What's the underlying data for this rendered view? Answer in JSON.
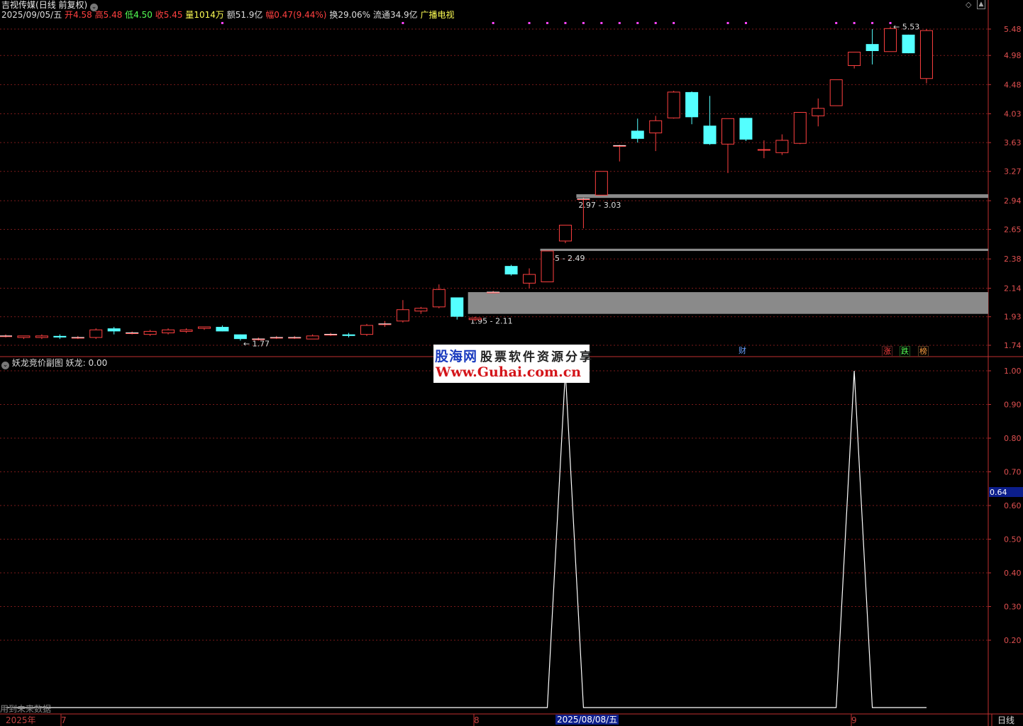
{
  "header": {
    "stock_name": "吉视传媒",
    "period_label": "(日线 前复权)",
    "date": "2025/09/05/五",
    "open_label": "开",
    "open": "4.58",
    "high_label": "高",
    "high": "5.48",
    "low_label": "低",
    "low": "4.50",
    "close_label": "收",
    "close": "5.45",
    "volume_label": "量",
    "volume": "1014万",
    "amount_label": "额",
    "amount": "51.9亿",
    "change_label": "幅",
    "change": "0.47(9.44%)",
    "turnover_label": "换",
    "turnover": "29.06%",
    "float_label": "流通",
    "float": "34.9亿",
    "sector": "广播电视"
  },
  "sub_header": {
    "indicator_name": "妖龙竞价副图",
    "series_label": "妖龙:",
    "series_value": "0.00"
  },
  "bottom_left_note": "用到未来数据",
  "x_axis": {
    "year": "2025年",
    "months": [
      "7",
      "8",
      "9"
    ],
    "selected_date": "2025/08/08/五",
    "period": "日线"
  },
  "badges": {
    "cai": "财",
    "zhang": "涨",
    "die": "跌",
    "bang": "榜"
  },
  "watermark": {
    "line1": "股海网",
    "line1b": "股票软件资源分享",
    "line2": "Www.Guhai.com.cn"
  },
  "colors": {
    "up": "#ff4040",
    "down": "#54ffff",
    "grid": "#7a1a1a",
    "border": "#c03030",
    "zone": "#8a8a8a",
    "indicator": "#ffffff",
    "magenta": "#ff44ff"
  },
  "chart_data": [
    {
      "type": "candlestick",
      "y_ticks": [
        5.48,
        4.98,
        4.48,
        4.03,
        3.63,
        3.27,
        2.94,
        2.65,
        2.38,
        2.14,
        1.93,
        1.74
      ],
      "y_scale": "log",
      "candles": [
        {
          "o": 1.8,
          "h": 1.81,
          "l": 1.79,
          "c": 1.8
        },
        {
          "o": 1.79,
          "h": 1.8,
          "l": 1.78,
          "c": 1.8
        },
        {
          "o": 1.79,
          "h": 1.81,
          "l": 1.78,
          "c": 1.8
        },
        {
          "o": 1.8,
          "h": 1.81,
          "l": 1.78,
          "c": 1.79
        },
        {
          "o": 1.79,
          "h": 1.8,
          "l": 1.78,
          "c": 1.79
        },
        {
          "o": 1.79,
          "h": 1.85,
          "l": 1.78,
          "c": 1.84
        },
        {
          "o": 1.85,
          "h": 1.86,
          "l": 1.81,
          "c": 1.83
        },
        {
          "o": 1.82,
          "h": 1.83,
          "l": 1.81,
          "c": 1.82
        },
        {
          "o": 1.81,
          "h": 1.84,
          "l": 1.8,
          "c": 1.83
        },
        {
          "o": 1.82,
          "h": 1.85,
          "l": 1.81,
          "c": 1.84
        },
        {
          "o": 1.83,
          "h": 1.85,
          "l": 1.82,
          "c": 1.84
        },
        {
          "o": 1.85,
          "h": 1.86,
          "l": 1.84,
          "c": 1.86
        },
        {
          "o": 1.86,
          "h": 1.87,
          "l": 1.83,
          "c": 1.83
        },
        {
          "o": 1.81,
          "h": 1.81,
          "l": 1.77,
          "c": 1.78
        },
        {
          "o": 1.78,
          "h": 1.79,
          "l": 1.77,
          "c": 1.78
        },
        {
          "o": 1.79,
          "h": 1.8,
          "l": 1.78,
          "c": 1.79
        },
        {
          "o": 1.79,
          "h": 1.8,
          "l": 1.78,
          "c": 1.79
        },
        {
          "o": 1.78,
          "h": 1.81,
          "l": 1.78,
          "c": 1.8
        },
        {
          "o": 1.81,
          "h": 1.82,
          "l": 1.8,
          "c": 1.81
        },
        {
          "o": 1.81,
          "h": 1.82,
          "l": 1.79,
          "c": 1.8
        },
        {
          "o": 1.81,
          "h": 1.88,
          "l": 1.8,
          "c": 1.87
        },
        {
          "o": 1.88,
          "h": 1.9,
          "l": 1.86,
          "c": 1.88
        },
        {
          "o": 1.9,
          "h": 2.05,
          "l": 1.89,
          "c": 1.98
        },
        {
          "o": 1.97,
          "h": 2.0,
          "l": 1.95,
          "c": 1.99
        },
        {
          "o": 2.0,
          "h": 2.17,
          "l": 1.99,
          "c": 2.13
        },
        {
          "o": 2.07,
          "h": 2.07,
          "l": 1.91,
          "c": 1.93
        },
        {
          "o": 1.91,
          "h": 1.93,
          "l": 1.9,
          "c": 1.92
        },
        {
          "o": 2.11,
          "h": 2.12,
          "l": 2.11,
          "c": 2.11
        },
        {
          "o": 2.32,
          "h": 2.33,
          "l": 2.24,
          "c": 2.25
        },
        {
          "o": 2.18,
          "h": 2.3,
          "l": 2.14,
          "c": 2.25
        },
        {
          "o": 2.19,
          "h": 2.45,
          "l": 2.19,
          "c": 2.45
        },
        {
          "o": 2.54,
          "h": 2.69,
          "l": 2.52,
          "c": 2.69
        },
        {
          "o": 2.96,
          "h": 2.97,
          "l": 2.66,
          "c": 2.96
        },
        {
          "o": 3.0,
          "h": 3.27,
          "l": 3.0,
          "c": 3.27
        },
        {
          "o": 3.59,
          "h": 3.6,
          "l": 3.39,
          "c": 3.59
        },
        {
          "o": 3.79,
          "h": 3.96,
          "l": 3.63,
          "c": 3.68
        },
        {
          "o": 3.76,
          "h": 4.0,
          "l": 3.52,
          "c": 3.93
        },
        {
          "o": 3.97,
          "h": 4.38,
          "l": 3.96,
          "c": 4.36
        },
        {
          "o": 4.36,
          "h": 4.37,
          "l": 3.88,
          "c": 3.98
        },
        {
          "o": 3.86,
          "h": 4.3,
          "l": 3.6,
          "c": 3.61
        },
        {
          "o": 3.61,
          "h": 3.96,
          "l": 3.25,
          "c": 3.96
        },
        {
          "o": 3.97,
          "h": 3.97,
          "l": 3.65,
          "c": 3.67
        },
        {
          "o": 3.53,
          "h": 3.66,
          "l": 3.43,
          "c": 3.54
        },
        {
          "o": 3.5,
          "h": 3.74,
          "l": 3.47,
          "c": 3.66
        },
        {
          "o": 3.62,
          "h": 4.05,
          "l": 3.61,
          "c": 4.05
        },
        {
          "o": 4.0,
          "h": 4.26,
          "l": 3.85,
          "c": 4.11
        },
        {
          "o": 4.15,
          "h": 4.56,
          "l": 4.15,
          "c": 4.56
        },
        {
          "o": 4.8,
          "h": 5.04,
          "l": 4.75,
          "c": 5.04
        },
        {
          "o": 5.19,
          "h": 5.48,
          "l": 4.82,
          "c": 5.06
        },
        {
          "o": 5.05,
          "h": 5.53,
          "l": 5.05,
          "c": 5.49
        },
        {
          "o": 5.37,
          "h": 5.37,
          "l": 5.02,
          "c": 5.02
        },
        {
          "o": 4.58,
          "h": 5.48,
          "l": 4.5,
          "c": 5.45
        }
      ],
      "annotations": [
        {
          "text": "← 1.77",
          "index": 13,
          "value": 1.77
        },
        {
          "text": "← 5.53",
          "index": 49,
          "value": 5.53
        }
      ],
      "zones": [
        {
          "label": "1.95 - 2.11",
          "low": 1.95,
          "high": 2.11,
          "start_index": 26
        },
        {
          "label": "2.45 - 2.49",
          "low": 2.45,
          "high": 2.47,
          "start_index": 30
        },
        {
          "label": "2.97 - 3.03",
          "low": 2.97,
          "high": 3.01,
          "start_index": 32
        }
      ],
      "marker_indices": [
        12,
        22,
        27,
        29,
        30,
        31,
        32,
        33,
        34,
        35,
        36,
        37,
        40,
        41,
        46,
        47,
        48,
        49
      ]
    },
    {
      "type": "line",
      "name": "妖龙",
      "y_ticks": [
        1.0,
        0.9,
        0.8,
        0.7,
        0.6,
        0.5,
        0.4,
        0.3,
        0.2
      ],
      "y_range": [
        0,
        1.05
      ],
      "cursor_value": "0.64",
      "values": [
        0,
        0,
        0,
        0,
        0,
        0,
        0,
        0,
        0,
        0,
        0,
        0,
        0,
        0,
        0,
        0,
        0,
        0,
        0,
        0,
        0,
        0,
        0,
        0,
        0,
        0,
        0,
        0,
        0,
        0,
        0,
        1,
        0,
        0,
        0,
        0,
        0,
        0,
        0,
        0,
        0,
        0,
        0,
        0,
        0,
        0,
        0,
        1,
        0,
        0,
        0,
        0
      ]
    }
  ]
}
